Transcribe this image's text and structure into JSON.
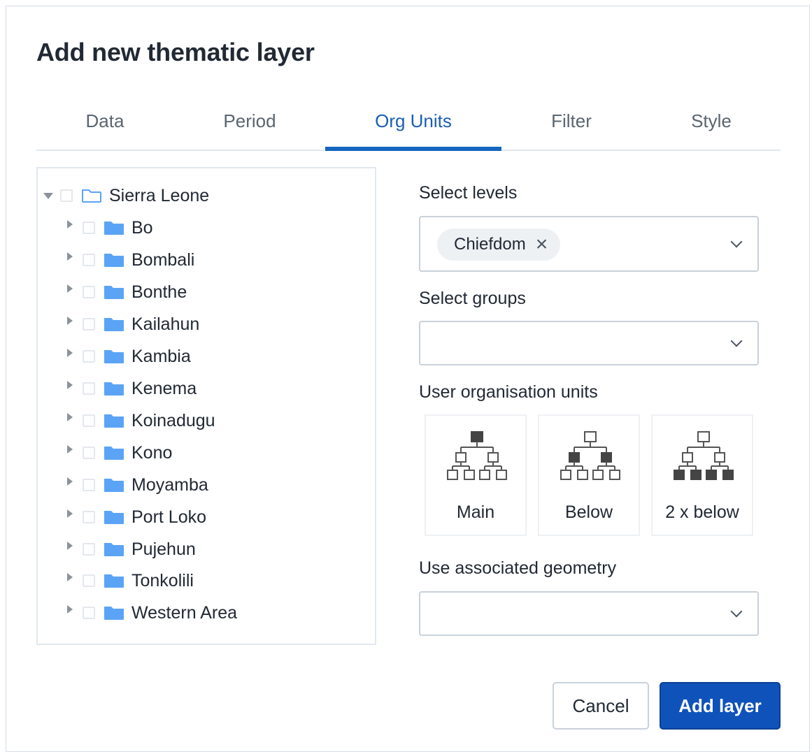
{
  "dialog": {
    "title": "Add new thematic layer",
    "tabs": [
      {
        "label": "Data",
        "active": false
      },
      {
        "label": "Period",
        "active": false
      },
      {
        "label": "Org Units",
        "active": true
      },
      {
        "label": "Filter",
        "active": false
      },
      {
        "label": "Style",
        "active": false
      }
    ]
  },
  "tree": {
    "root": {
      "label": "Sierra Leone",
      "expanded": true,
      "checked": false
    },
    "children": [
      {
        "label": "Bo",
        "checked": false
      },
      {
        "label": "Bombali",
        "checked": false
      },
      {
        "label": "Bonthe",
        "checked": false
      },
      {
        "label": "Kailahun",
        "checked": false
      },
      {
        "label": "Kambia",
        "checked": false
      },
      {
        "label": "Kenema",
        "checked": false
      },
      {
        "label": "Koinadugu",
        "checked": false
      },
      {
        "label": "Kono",
        "checked": false
      },
      {
        "label": "Moyamba",
        "checked": false
      },
      {
        "label": "Port Loko",
        "checked": false
      },
      {
        "label": "Pujehun",
        "checked": false
      },
      {
        "label": "Tonkolili",
        "checked": false
      },
      {
        "label": "Western Area",
        "checked": false
      }
    ]
  },
  "levels": {
    "label": "Select levels",
    "selected": [
      "Chiefdom"
    ]
  },
  "groups": {
    "label": "Select groups",
    "value": ""
  },
  "user_org_units": {
    "label": "User organisation units",
    "options": [
      {
        "label": "Main",
        "icon": "org-tree-main-icon"
      },
      {
        "label": "Below",
        "icon": "org-tree-below-icon"
      },
      {
        "label": "2 x below",
        "icon": "org-tree-2x-below-icon"
      }
    ]
  },
  "geometry": {
    "label": "Use associated geometry",
    "value": ""
  },
  "actions": {
    "cancel": "Cancel",
    "add": "Add layer"
  },
  "colors": {
    "accent": "#1565c0",
    "primary_button": "#0f52ba",
    "folder": "#5ba4f5"
  }
}
